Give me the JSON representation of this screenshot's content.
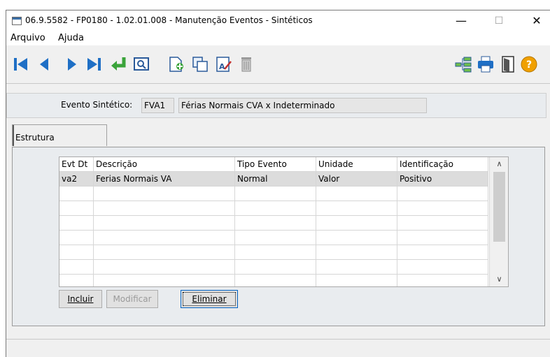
{
  "window": {
    "title": "06.9.5582 - FP0180 - 1.02.01.008 - Manutenção Eventos - Sintéticos",
    "minimize_glyph": "—",
    "maximize_glyph": "☐",
    "close_glyph": "✕"
  },
  "menu": {
    "items": [
      "Arquivo",
      "Ajuda"
    ]
  },
  "toolbar": {
    "icons": [
      "first-record-icon",
      "previous-record-icon",
      "next-record-icon",
      "last-record-icon",
      "return-icon",
      "search-icon",
      "new-document-icon",
      "copy-icon",
      "edit-icon",
      "delete-icon",
      "tree-icon",
      "print-icon",
      "exit-door-icon",
      "help-icon"
    ],
    "help_glyph": "?",
    "colors": {
      "nav_blue": "#1f6fc5",
      "return_green": "#3aa33a",
      "help_orange": "#f0a000"
    }
  },
  "header": {
    "label": "Evento Sintético:",
    "code": "FVA1",
    "description": "Férias Normais CVA x Indeterminado"
  },
  "tabs": [
    {
      "label": "Estrutura"
    }
  ],
  "grid": {
    "columns": [
      "Evt Dt",
      "Descrição",
      "Tipo Evento",
      "Unidade",
      "Identificação"
    ],
    "rows": [
      [
        "va2",
        "Ferias Normais VA",
        "Normal",
        "Valor",
        "Positivo"
      ]
    ],
    "scroll_up": "∧",
    "scroll_down": "∨"
  },
  "buttons": {
    "incluir": "Incluir",
    "modificar": "Modificar",
    "eliminar": "Eliminar"
  }
}
